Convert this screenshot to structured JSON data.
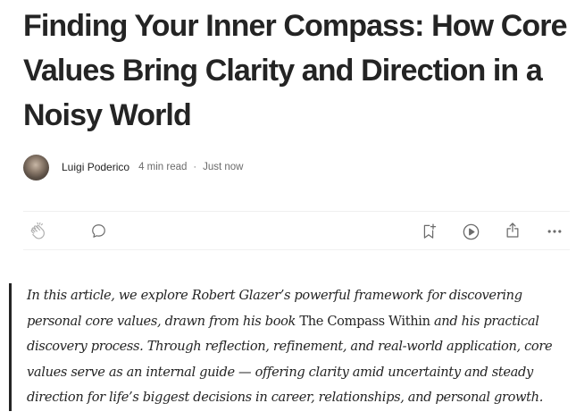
{
  "article": {
    "title": "Finding Your Inner Compass: How Core Values Bring Clarity and Direction in a Noisy World"
  },
  "byline": {
    "author": "Luigi Poderico",
    "read_time": "4 min read",
    "separator": "·",
    "published": "Just now"
  },
  "actions": {
    "icons": [
      "clap-icon",
      "comment-icon",
      "bookmark-add-icon",
      "listen-play-icon",
      "share-icon",
      "more-icon"
    ]
  },
  "quote": {
    "part1": "In this article, we explore Robert Glazer’s powerful framework for discovering personal core values, drawn from his book ",
    "book_title": "The Compass Within",
    "part2": " and his practical discovery process. Through reflection, refinement, and real-world application, core values serve as an internal guide — offering clarity amid uncertainty and steady direction for life’s biggest decisions in career, relationships, and personal growth."
  },
  "colors": {
    "text": "#242424",
    "muted": "#6b6b6b",
    "icon": "#6b6b6b",
    "divider": "#f0f0f0"
  }
}
